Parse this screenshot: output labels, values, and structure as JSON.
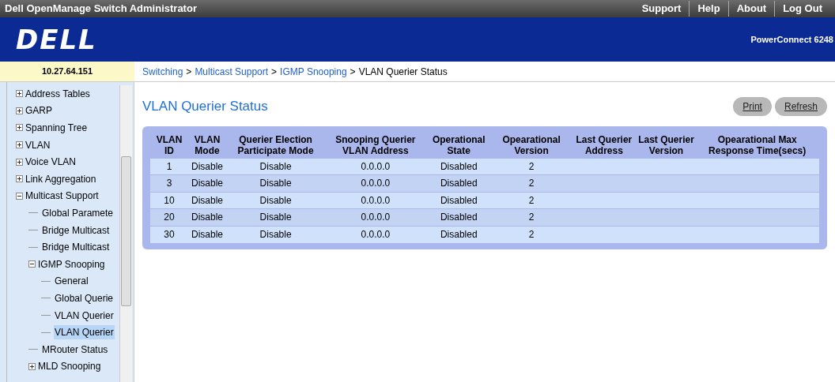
{
  "top_bar": {
    "title": "Dell OpenManage Switch Administrator",
    "links": [
      "Support",
      "Help",
      "About",
      "Log Out"
    ]
  },
  "banner": {
    "logo": "DELL",
    "model": "PowerConnect 6248"
  },
  "ip_address": "10.27.64.151",
  "breadcrumb_separator": ">",
  "breadcrumb": [
    {
      "label": "Switching",
      "link": true
    },
    {
      "label": "Multicast Support",
      "link": true
    },
    {
      "label": "IGMP Snooping",
      "link": true
    },
    {
      "label": "VLAN Querier Status",
      "link": false
    }
  ],
  "sidebar": {
    "items": [
      {
        "label": "Address Tables",
        "expanded": false,
        "selected": false
      },
      {
        "label": "GARP",
        "expanded": false,
        "selected": false
      },
      {
        "label": "Spanning Tree",
        "expanded": false,
        "selected": false
      },
      {
        "label": "VLAN",
        "expanded": false,
        "selected": false
      },
      {
        "label": "Voice VLAN",
        "expanded": false,
        "selected": false
      },
      {
        "label": "Link Aggregation",
        "expanded": false,
        "selected": false
      },
      {
        "label": "Multicast Support",
        "expanded": true,
        "selected": false,
        "children": [
          {
            "label": "Global Paramete",
            "selected": false
          },
          {
            "label": "Bridge Multicast",
            "selected": false
          },
          {
            "label": "Bridge Multicast",
            "selected": false
          },
          {
            "label": "IGMP Snooping",
            "expanded": true,
            "selected": false,
            "children": [
              {
                "label": "General",
                "selected": false
              },
              {
                "label": "Global Querie",
                "selected": false
              },
              {
                "label": "VLAN Querier",
                "selected": false
              },
              {
                "label": "VLAN Querier",
                "selected": true
              }
            ]
          },
          {
            "label": "MRouter Status",
            "selected": false
          },
          {
            "label": "MLD Snooping",
            "expanded": false,
            "selected": false
          }
        ]
      }
    ]
  },
  "page_title": "VLAN Querier Status",
  "buttons": [
    "Print",
    "Refresh"
  ],
  "table": {
    "columns": [
      "VLAN\nID",
      "VLAN\nMode",
      "Querier Election\nParticipate Mode",
      "Snooping Querier\nVLAN Address",
      "Operational\nState",
      "Opearational\nVersion",
      "Last Querier\nAddress",
      "Last Querier\nVersion",
      "Opearational Max\nResponse Time(secs)"
    ],
    "rows": [
      [
        "1",
        "Disable",
        "Disable",
        "0.0.0.0",
        "Disabled",
        "2"
      ],
      [
        "3",
        "Disable",
        "Disable",
        "0.0.0.0",
        "Disabled",
        "2"
      ],
      [
        "10",
        "Disable",
        "Disable",
        "0.0.0.0",
        "Disabled",
        "2"
      ],
      [
        "20",
        "Disable",
        "Disable",
        "0.0.0.0",
        "Disabled",
        "2"
      ],
      [
        "30",
        "Disable",
        "Disable",
        "0.0.0.0",
        "Disabled",
        "2"
      ]
    ]
  }
}
